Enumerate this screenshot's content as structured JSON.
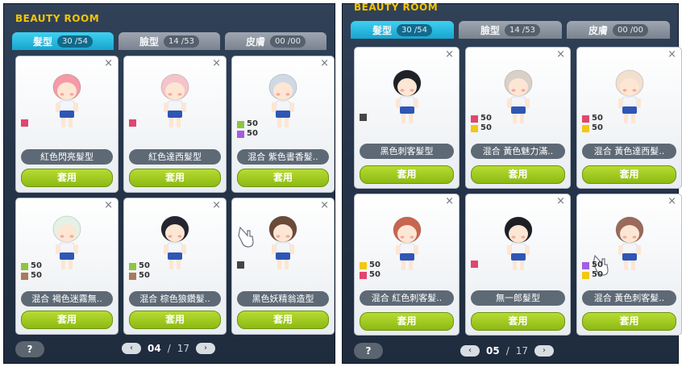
{
  "panels": [
    {
      "title": "BEAUTY ROOM",
      "tabs": [
        {
          "label": "髮型",
          "count": "30 /54",
          "active": true
        },
        {
          "label": "臉型",
          "count": "14 /53",
          "active": false
        },
        {
          "label": "皮膚",
          "count": "00 /00",
          "active": false
        }
      ],
      "cards": [
        {
          "name": "紅色閃亮髮型",
          "hair": "#f59aa6",
          "swatches": [
            {
              "color": "#e0476e",
              "value": ""
            }
          ],
          "pointer": false
        },
        {
          "name": "紅色達西髮型",
          "hair": "#f6c3cb",
          "swatches": [
            {
              "color": "#e0476e",
              "value": ""
            }
          ],
          "pointer": false
        },
        {
          "name": "混合 紫色書香髮..",
          "hair": "#cfd9e6",
          "swatches": [
            {
              "color": "#8cc63f",
              "value": "50"
            },
            {
              "color": "#a45de0",
              "value": "50"
            }
          ],
          "pointer": false
        },
        {
          "name": "混合 褐色迷霧無..",
          "hair": "#e4f2e6",
          "swatches": [
            {
              "color": "#8cc63f",
              "value": "50"
            },
            {
              "color": "#a97b5b",
              "value": "50"
            }
          ],
          "pointer": false
        },
        {
          "name": "混合 棕色狼鑽髮..",
          "hair": "#232630",
          "swatches": [
            {
              "color": "#8cc63f",
              "value": "50"
            },
            {
              "color": "#a97b5b",
              "value": "50"
            }
          ],
          "pointer": false
        },
        {
          "name": "黑色妖精翁造型",
          "hair": "#6b4a3a",
          "swatches": [
            {
              "color": "#444444",
              "value": ""
            }
          ],
          "pointer": true
        }
      ],
      "page": {
        "current": "04",
        "total": "17"
      },
      "help_label": "?"
    },
    {
      "title": "BEAUTY ROOM",
      "tabs": [
        {
          "label": "髮型",
          "count": "30 /54",
          "active": true
        },
        {
          "label": "臉型",
          "count": "14 /53",
          "active": false
        },
        {
          "label": "皮膚",
          "count": "00 /00",
          "active": false
        }
      ],
      "cards": [
        {
          "name": "黑色刺客髮型",
          "hair": "#1f2128",
          "swatches": [
            {
              "color": "#444444",
              "value": ""
            }
          ],
          "pointer": false
        },
        {
          "name": "混合 黃色魅力滿..",
          "hair": "#d9d0c8",
          "swatches": [
            {
              "color": "#e0476e",
              "value": "50"
            },
            {
              "color": "#f2c811",
              "value": "50"
            }
          ],
          "pointer": false
        },
        {
          "name": "混合 黃色達西髮..",
          "hair": "#f2e0cf",
          "swatches": [
            {
              "color": "#e0476e",
              "value": "50"
            },
            {
              "color": "#f2c811",
              "value": "50"
            }
          ],
          "pointer": false
        },
        {
          "name": "混合 紅色刺客髮..",
          "hair": "#c8654e",
          "swatches": [
            {
              "color": "#f2c811",
              "value": "50"
            },
            {
              "color": "#e0476e",
              "value": "50"
            }
          ],
          "pointer": false
        },
        {
          "name": "無一郎髮型",
          "hair": "#1d1f24",
          "swatches": [
            {
              "color": "#e0476e",
              "value": ""
            }
          ],
          "pointer": false
        },
        {
          "name": "混合 黃色刺客髮..",
          "hair": "#9a6a5a",
          "swatches": [
            {
              "color": "#a45de0",
              "value": "50"
            },
            {
              "color": "#f2c811",
              "value": "50"
            }
          ],
          "pointer": true
        }
      ],
      "page": {
        "current": "05",
        "total": "17"
      },
      "help_label": "?"
    }
  ],
  "labels": {
    "apply": "套用",
    "close": "×",
    "prev": "‹",
    "next": "›",
    "slash": "/"
  }
}
